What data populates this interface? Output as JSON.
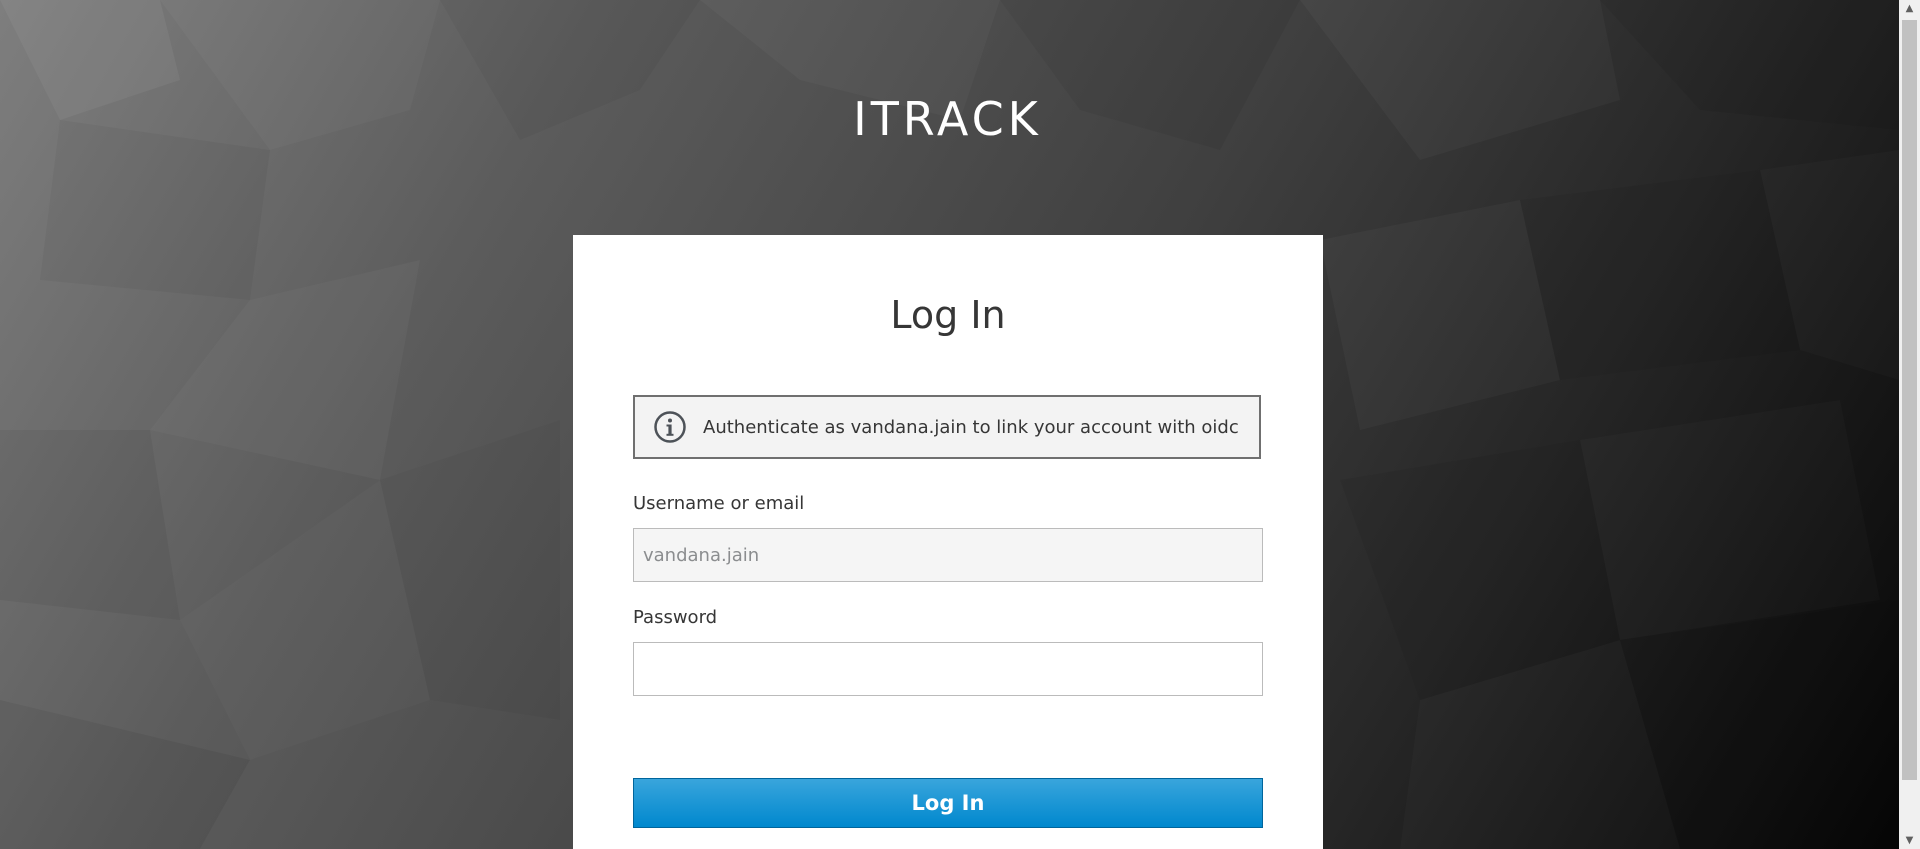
{
  "brand": {
    "title": "ITRACK"
  },
  "login": {
    "heading": "Log In",
    "info_message": "Authenticate as vandana.jain to link your account with oidc",
    "username_label": "Username or email",
    "username_value": "vandana.jain",
    "password_label": "Password",
    "password_value": "",
    "submit_label": "Log In"
  },
  "icons": {
    "info": "info-circle-icon",
    "scroll_up": "scroll-up-arrow-icon",
    "scroll_down": "scroll-down-arrow-icon"
  },
  "colors": {
    "primary_button": "#0088ce",
    "alert_border": "#6f6f6f",
    "text": "#363636"
  }
}
